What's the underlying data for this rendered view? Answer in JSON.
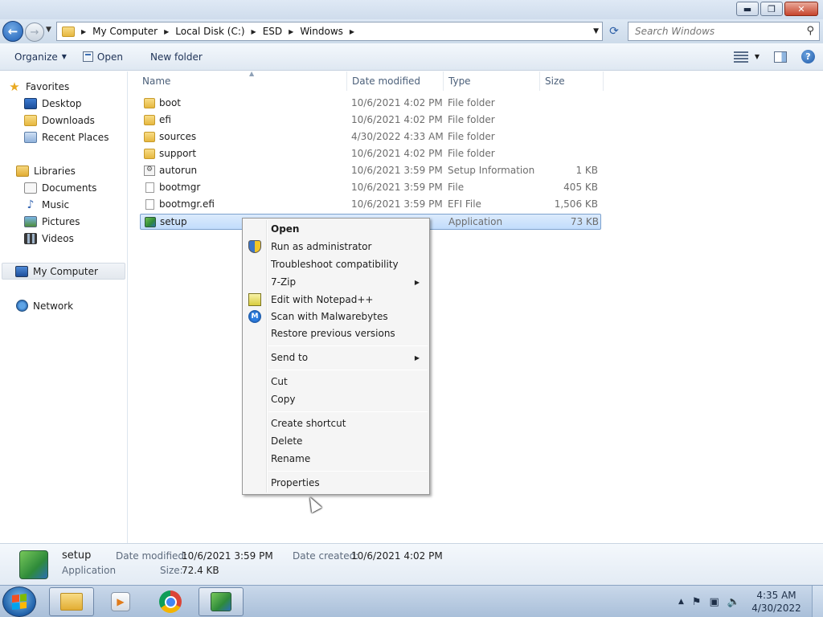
{
  "window": {
    "minimize": "▬",
    "maximize": "❐",
    "close": "✕"
  },
  "address": {
    "segments": [
      "My Computer",
      "Local Disk (C:)",
      "ESD",
      "Windows"
    ]
  },
  "search": {
    "placeholder": "Search Windows"
  },
  "toolbar": {
    "organize": "Organize",
    "open": "Open",
    "new_folder": "New folder"
  },
  "nav": {
    "favorites": "Favorites",
    "desktop": "Desktop",
    "downloads": "Downloads",
    "recent": "Recent Places",
    "libraries": "Libraries",
    "documents": "Documents",
    "music": "Music",
    "pictures": "Pictures",
    "videos": "Videos",
    "computer": "My Computer",
    "network": "Network"
  },
  "columns": {
    "name": "Name",
    "date": "Date modified",
    "type": "Type",
    "size": "Size"
  },
  "files": [
    {
      "name": "boot",
      "date": "10/6/2021 4:02 PM",
      "type": "File folder",
      "size": ""
    },
    {
      "name": "efi",
      "date": "10/6/2021 4:02 PM",
      "type": "File folder",
      "size": ""
    },
    {
      "name": "sources",
      "date": "4/30/2022 4:33 AM",
      "type": "File folder",
      "size": ""
    },
    {
      "name": "support",
      "date": "10/6/2021 4:02 PM",
      "type": "File folder",
      "size": ""
    },
    {
      "name": "autorun",
      "date": "10/6/2021 3:59 PM",
      "type": "Setup Information",
      "size": "1 KB"
    },
    {
      "name": "bootmgr",
      "date": "10/6/2021 3:59 PM",
      "type": "File",
      "size": "405 KB"
    },
    {
      "name": "bootmgr.efi",
      "date": "10/6/2021 3:59 PM",
      "type": "EFI File",
      "size": "1,506 KB"
    },
    {
      "name": "setup",
      "date": "",
      "type": "Application",
      "size": "73 KB"
    }
  ],
  "context_menu": {
    "open": "Open",
    "run_admin": "Run as administrator",
    "troubleshoot": "Troubleshoot compatibility",
    "zip": "7-Zip",
    "notepad": "Edit with Notepad++",
    "malwarebytes": "Scan with Malwarebytes",
    "restore": "Restore previous versions",
    "send_to": "Send to",
    "cut": "Cut",
    "copy": "Copy",
    "create_shortcut": "Create shortcut",
    "delete": "Delete",
    "rename": "Rename",
    "properties": "Properties"
  },
  "details": {
    "name": "setup",
    "type": "Application",
    "modified_label": "Date modified:",
    "modified_value": "10/6/2021 3:59 PM",
    "created_label": "Date created:",
    "created_value": "10/6/2021 4:02 PM",
    "size_label": "Size:",
    "size_value": "72.4 KB"
  },
  "clock": {
    "time": "4:35 AM",
    "date": "4/30/2022"
  }
}
